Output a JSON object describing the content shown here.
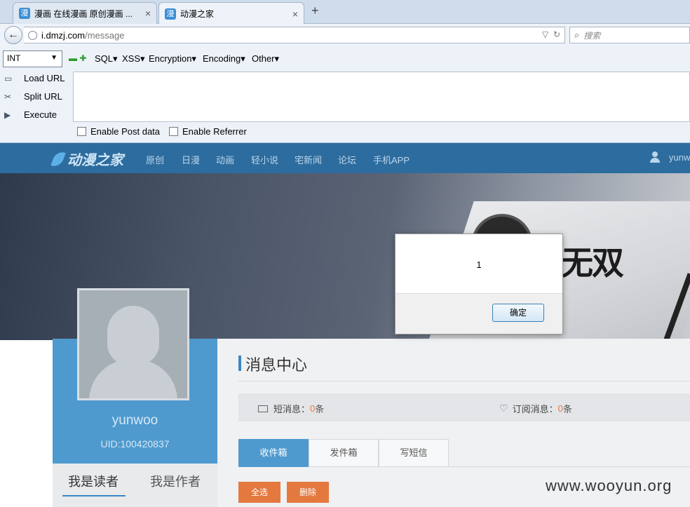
{
  "browser": {
    "tabs": [
      {
        "favicon": "漫",
        "title": "漫画 在线漫画 原创漫画 ..."
      },
      {
        "favicon": "漫",
        "title": "动漫之家"
      }
    ],
    "new_tab": "+",
    "close_glyph": "×",
    "address": {
      "host": "i.dmzj.com",
      "path": "/message"
    },
    "search_placeholder": "搜索"
  },
  "hackbar": {
    "select_value": "INT",
    "menus": [
      "SQL",
      "XSS",
      "Encryption",
      "Encoding",
      "Other"
    ],
    "actions": [
      "Load URL",
      "Split URL",
      "Execute"
    ],
    "checkboxes": [
      "Enable Post data",
      "Enable Referrer"
    ]
  },
  "site": {
    "logo": "动漫之家",
    "nav": [
      "原创",
      "日漫",
      "动画",
      "轻小说",
      "宅新闻",
      "论坛",
      "手机APP"
    ],
    "user": "yunw",
    "banner_text": "无双"
  },
  "profile": {
    "username": "yunwoo",
    "uid": "UID:100420837",
    "tabs": [
      "我是读者",
      "我是作者"
    ]
  },
  "messages": {
    "title": "消息中心",
    "stats": [
      {
        "label": "短消息：",
        "count": "0",
        "unit": "条"
      },
      {
        "label": "订阅消息：",
        "count": "0",
        "unit": "条"
      }
    ],
    "tabs": [
      "收件箱",
      "发件箱",
      "写短信"
    ],
    "buttons": [
      "全选",
      "删除"
    ]
  },
  "alert": {
    "message": "1",
    "ok": "确定"
  },
  "watermark": "www.wooyun.org",
  "colors": {
    "site_header": "#2d6c9e",
    "accent_blue": "#4e9acf",
    "accent_orange": "#e4793f"
  }
}
